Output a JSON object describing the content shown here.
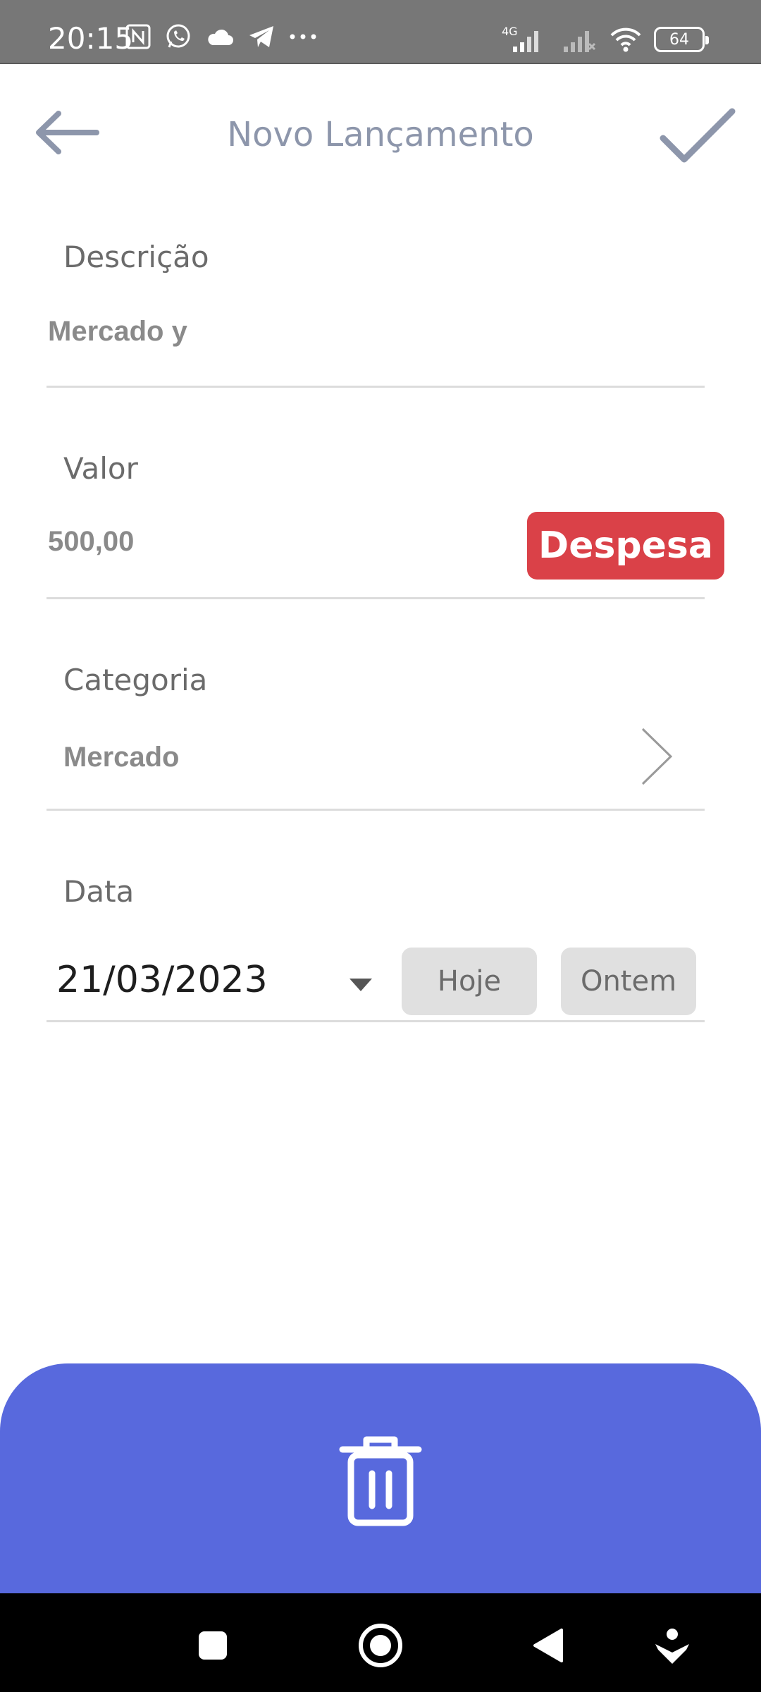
{
  "status_bar": {
    "time": "20:15",
    "network_label": "4G",
    "battery": "64",
    "icons": [
      "nfc-icon",
      "whatsapp-icon",
      "cloud-icon",
      "telegram-icon",
      "more-dots-icon",
      "signal-4g-icon",
      "signal-empty-icon",
      "wifi-icon",
      "battery-icon"
    ]
  },
  "header": {
    "title": "Novo Lançamento",
    "back_icon": "arrow-left-icon",
    "confirm_icon": "checkmark-icon"
  },
  "form": {
    "descricao": {
      "label": "Descrição",
      "value": "Mercado y"
    },
    "valor": {
      "label": "Valor",
      "value": "500,00",
      "type_button": "Despesa"
    },
    "categoria": {
      "label": "Categoria",
      "value": "Mercado",
      "icon": "chevron-right-icon"
    },
    "data": {
      "label": "Data",
      "value": "21/03/2023",
      "today_button": "Hoje",
      "yesterday_button": "Ontem"
    }
  },
  "bottom_action": {
    "icon": "trash-icon"
  },
  "nav_bar": {
    "icons": [
      "recents-square-icon",
      "home-circle-icon",
      "back-triangle-icon",
      "accessibility-icon"
    ]
  },
  "colors": {
    "accent": "#5869dd",
    "expense": "#da4148",
    "title": "#8d96ab",
    "status_bar": "#777777"
  }
}
